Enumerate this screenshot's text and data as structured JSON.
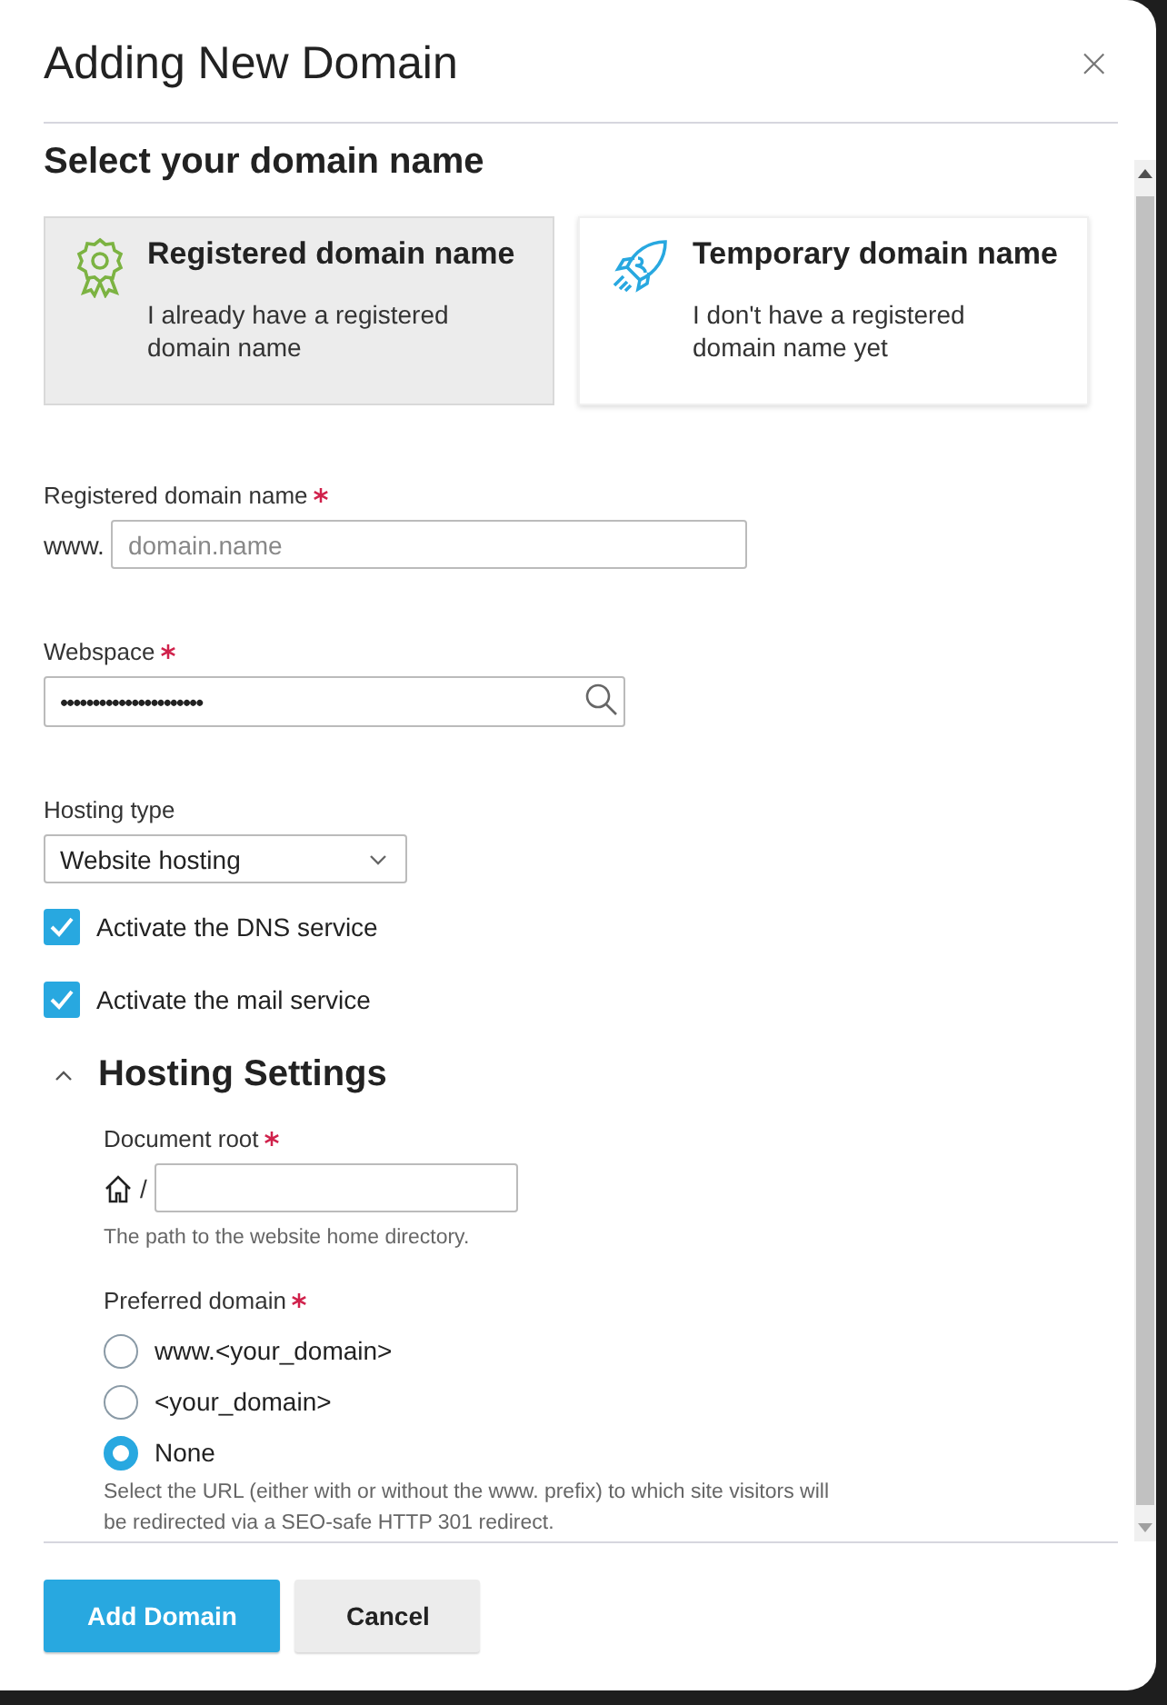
{
  "dialog": {
    "title": "Adding New Domain",
    "close_label": "×"
  },
  "section_title": "Select your domain name",
  "domain_options": [
    {
      "kind": "registered",
      "title": "Registered domain name",
      "description": "I already have a registered domain name",
      "selected": true
    },
    {
      "kind": "temporary",
      "title": "Temporary domain name",
      "description": "I don't have a registered domain name yet",
      "selected": false
    }
  ],
  "domain_field": {
    "label": "Registered domain name",
    "required": true,
    "prefix": "www.",
    "placeholder": "domain.name"
  },
  "webspace_field": {
    "label": "Webspace",
    "required": true,
    "value": "••••••••••••••••••••••"
  },
  "hosting_type": {
    "label": "Hosting type",
    "value": "Website hosting"
  },
  "services": [
    {
      "label": "Activate the DNS service",
      "checked": true
    },
    {
      "label": "Activate the mail service",
      "checked": true
    }
  ],
  "hosting_settings": {
    "title": "Hosting Settings",
    "expanded": true,
    "document_root": {
      "label": "Document root",
      "required": true,
      "separator": "/",
      "hint": "The path to the website home directory."
    },
    "preferred_domain": {
      "label": "Preferred domain",
      "required": true,
      "options": [
        {
          "label": "www.<your_domain>",
          "selected": false
        },
        {
          "label": "<your_domain>",
          "selected": false
        },
        {
          "label": "None",
          "selected": true
        }
      ],
      "hint": "Select the URL (either with or without the www. prefix) to which site visitors will be redirected via a SEO-safe HTTP 301 redirect."
    }
  },
  "buttons": [
    {
      "label": "Add Domain",
      "kind": "primary"
    },
    {
      "label": "Cancel",
      "kind": "secondary"
    }
  ]
}
